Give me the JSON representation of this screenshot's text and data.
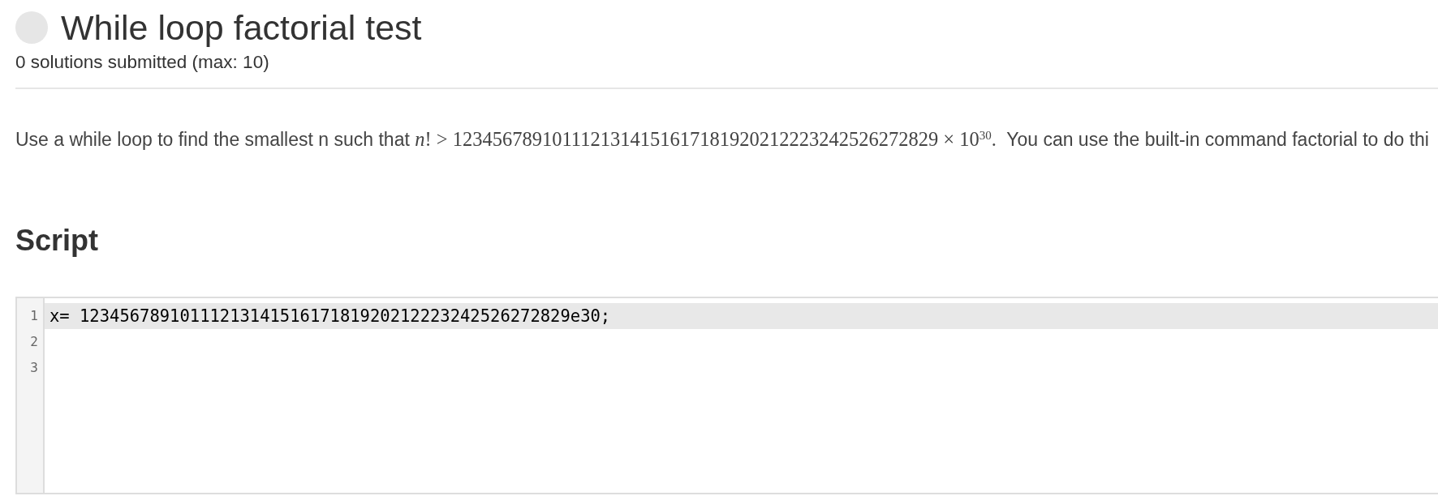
{
  "problem": {
    "solved": false,
    "title": "While loop factorial test",
    "submissions": "0 solutions submitted (max: 10)"
  },
  "description": [
    {
      "kind": "text",
      "text": "Use a while loop to find the smallest n such that "
    },
    {
      "kind": "math",
      "text": "*n*! > 1234567891011121314151617181920212223242526272829 × 10$^{30}$."
    },
    {
      "kind": "text",
      "text": "  You can use the built-in command factorial to do thi"
    }
  ],
  "script": {
    "heading": "Script",
    "lines": [
      {
        "number": "1",
        "code": "x= 1234567891011121314151617181920212223242526272829e30;",
        "active": true
      },
      {
        "number": "2",
        "active": false
      },
      {
        "number": "3",
        "active": false
      }
    ]
  }
}
